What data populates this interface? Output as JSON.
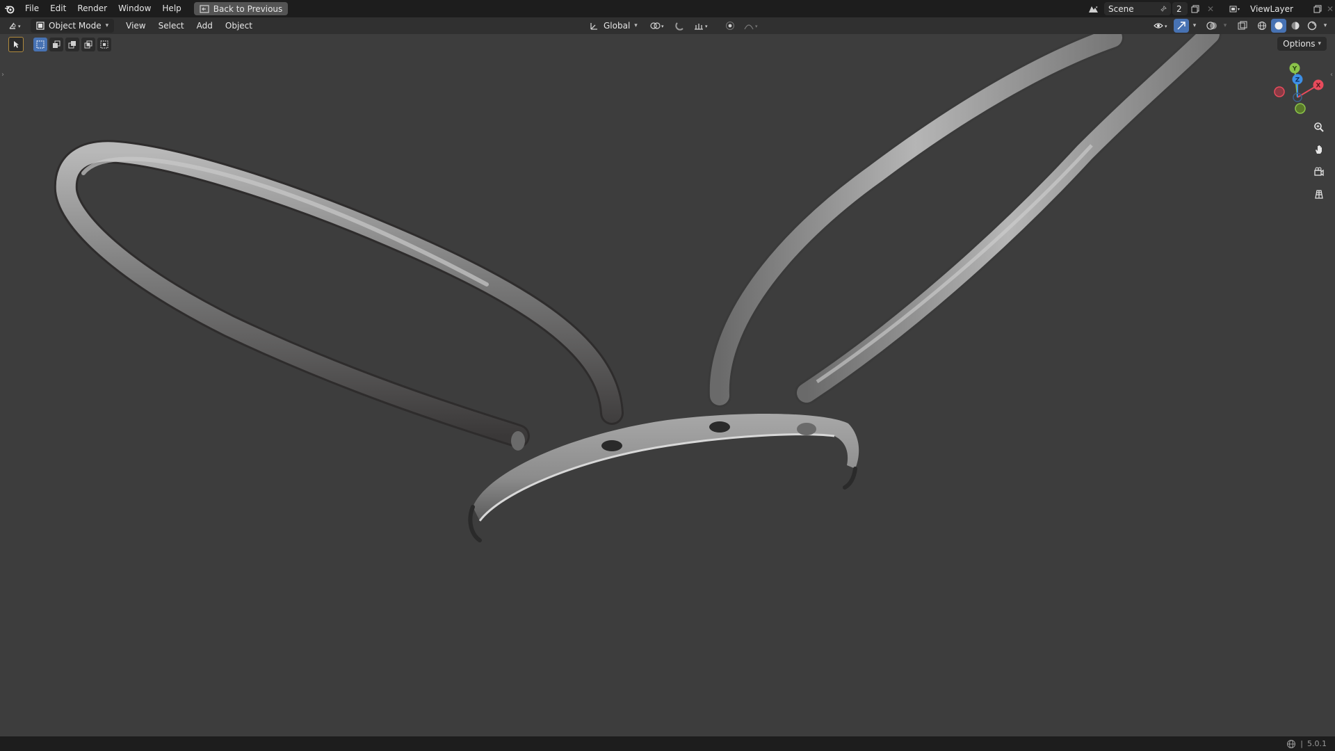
{
  "topbar": {
    "menu": [
      "File",
      "Edit",
      "Render",
      "Window",
      "Help"
    ],
    "back_label": "Back to Previous",
    "scene_label": "Scene",
    "scene_users": "2",
    "view_layer_label": "ViewLayer"
  },
  "header": {
    "mode_label": "Object Mode",
    "menu": [
      "View",
      "Select",
      "Add",
      "Object"
    ],
    "transform_orientation": "Global",
    "options_label": "Options"
  },
  "gizmo": {
    "x": "X",
    "y": "Y",
    "z": "Z"
  },
  "status": {
    "version": "5.0.1"
  },
  "colors": {
    "axis_x": "#e84b5c",
    "axis_y": "#8bc34a",
    "axis_z": "#3d8fe6",
    "accent": "#4772b3",
    "mesh": "#8a8a8a"
  },
  "icons": [
    "blender-logo-icon",
    "back-icon",
    "scene-icon",
    "pin-icon",
    "new-scene-icon",
    "viewlayer-icon",
    "editor-type-icon",
    "object-mode-icon",
    "orientation-icon",
    "pivot-icon",
    "snap-icon",
    "snap-increment-icon",
    "proportional-icon",
    "falloff-icon",
    "visibility-icon",
    "gizmo-icon",
    "overlay-icon",
    "xray-icon",
    "wireframe-shading-icon",
    "solid-shading-icon",
    "material-shading-icon",
    "rendered-shading-icon",
    "select-tool-icon",
    "zoom-icon",
    "hand-pan-icon",
    "camera-view-icon",
    "ortho-grid-icon"
  ]
}
